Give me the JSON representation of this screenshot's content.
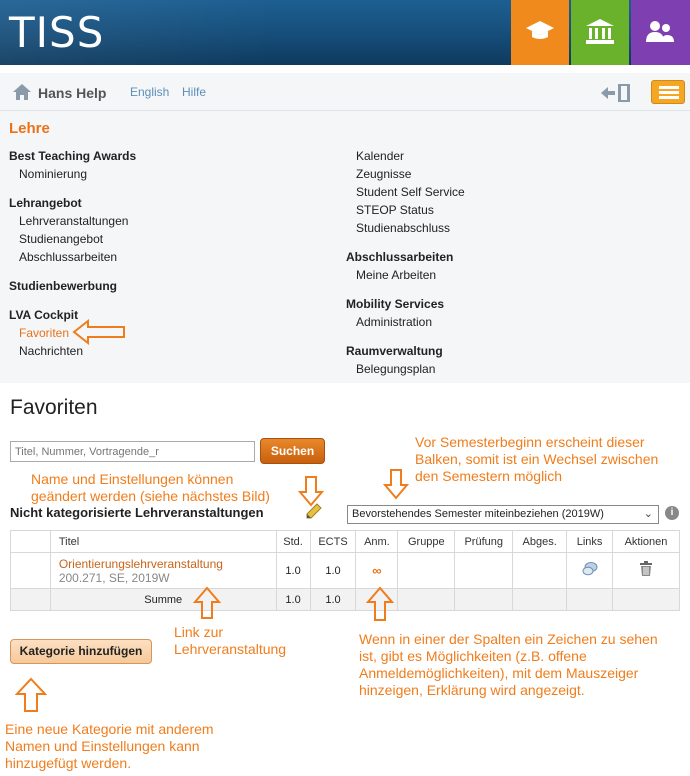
{
  "header": {
    "logo": "TISS",
    "tabs": [
      {
        "name": "lehre",
        "icon": "graduation-cap-icon",
        "color": "#f08a1c"
      },
      {
        "name": "organisation",
        "icon": "building-icon",
        "color": "#6bb22c"
      },
      {
        "name": "community",
        "icon": "people-icon",
        "color": "#7e3fb0"
      }
    ]
  },
  "topnav": {
    "user": "Hans Help",
    "language": "English",
    "help": "Hilfe"
  },
  "menu": {
    "title": "Lehre",
    "left": [
      {
        "heading": "Best Teaching Awards",
        "items": [
          "Nominierung"
        ]
      },
      {
        "heading": "Lehrangebot",
        "items": [
          "Lehrveranstaltungen",
          "Studienangebot",
          "Abschlussarbeiten"
        ]
      },
      {
        "heading": "Studienbewerbung",
        "items": []
      },
      {
        "heading": "LVA Cockpit",
        "items": [
          "Favoriten",
          "Nachrichten"
        ]
      }
    ],
    "right": [
      {
        "heading": "",
        "items": [
          "Kalender",
          "Zeugnisse",
          "Student Self Service",
          "STEOP Status",
          "Studienabschluss"
        ]
      },
      {
        "heading": "Abschlussarbeiten",
        "items": [
          "Meine Arbeiten"
        ]
      },
      {
        "heading": "Mobility Services",
        "items": [
          "Administration"
        ]
      },
      {
        "heading": "Raumverwaltung",
        "items": [
          "Belegungsplan"
        ]
      }
    ]
  },
  "content": {
    "title": "Favoriten",
    "search": {
      "placeholder": "Titel, Nummer, Vortragende_r",
      "button": "Suchen"
    },
    "category_title": "Nicht kategorisierte Lehrveranstaltungen",
    "semester_select": "Bevorstehendes Semester miteinbeziehen (2019W)",
    "table": {
      "headers": [
        "",
        "Titel",
        "Std.",
        "ECTS",
        "Anm.",
        "Gruppe",
        "Prüfung",
        "Abges.",
        "Links",
        "Aktionen"
      ],
      "row": {
        "title": "Orientierungslehrveranstaltung",
        "sub": "200.271, SE, 2019W",
        "std": "1.0",
        "ects": "1.0",
        "anm": "∞"
      },
      "sum": {
        "label": "Summe",
        "std": "1.0",
        "ects": "1.0"
      }
    },
    "add_category": "Kategorie hinzufügen"
  },
  "annotations": {
    "name_settings": "Name und Einstellungen können\ngeändert werden (siehe nächstes Bild)",
    "semester_bar": "Vor Semesterbeginn erscheint dieser\nBalken, somit ist ein Wechsel zwischen\nden Semestern möglich",
    "course_link": "Link zur\nLehrveranstaltung",
    "symbol_hint": "Wenn in einer der Spalten ein Zeichen zu sehen\nist, gibt es Möglichkeiten (z.B. offene\nAnmeldemöglichkeiten), mit dem Mauszeiger\nhinzeigen, Erklärung wird angezeigt.",
    "new_category": "Eine neue Kategorie mit anderem\nNamen und Einstellungen kann\nhinzugefügt werden."
  }
}
